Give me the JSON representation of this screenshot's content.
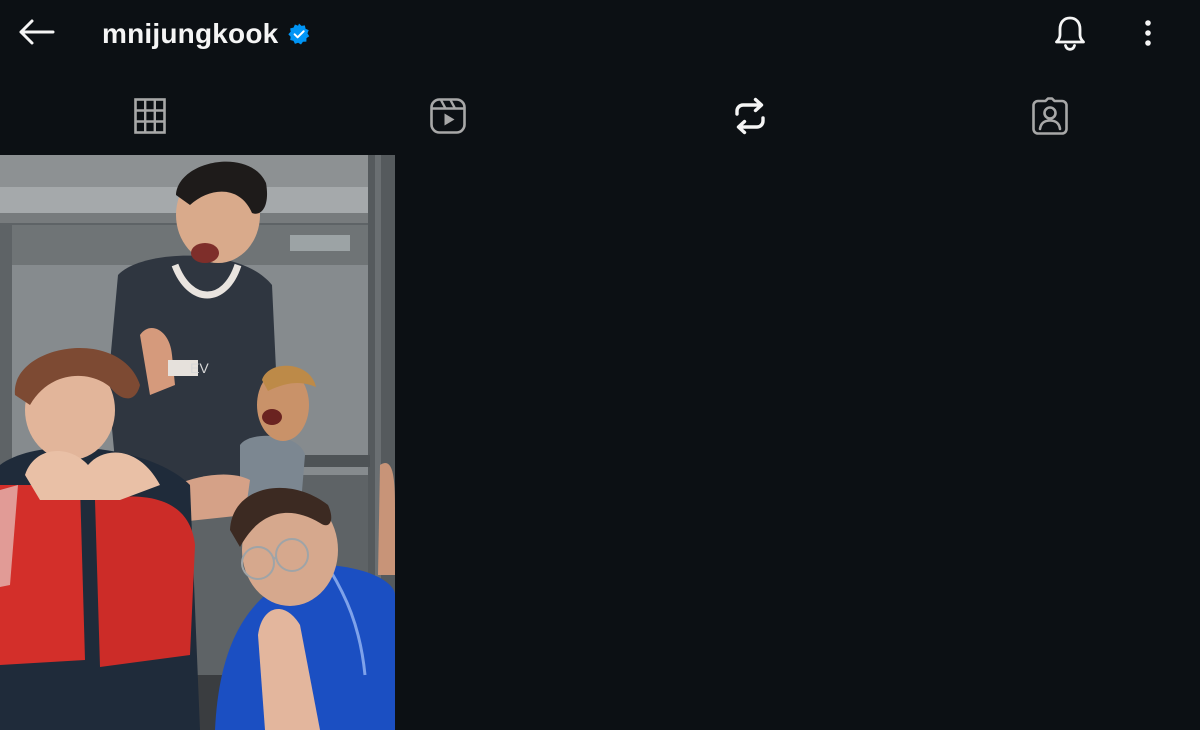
{
  "header": {
    "username": "mnijungkook",
    "back_icon": "arrow-left-icon",
    "verified_icon": "verified-badge-icon",
    "notifications_icon": "bell-icon",
    "more_icon": "more-vertical-icon"
  },
  "tabs": [
    {
      "name": "posts",
      "icon": "grid-icon",
      "active": false
    },
    {
      "name": "reels",
      "icon": "reels-icon",
      "active": false
    },
    {
      "name": "reposts",
      "icon": "repost-icon",
      "active": true
    },
    {
      "name": "tagged",
      "icon": "tagged-person-icon",
      "active": false
    }
  ],
  "grid": {
    "posts": [
      {
        "type": "photo",
        "description_icon": "photo-thumbnail"
      }
    ]
  },
  "colors": {
    "background": "#0c1014",
    "text": "#f5f5f5",
    "icon_inactive": "#a8a8a8",
    "verified": "#0095f6"
  }
}
